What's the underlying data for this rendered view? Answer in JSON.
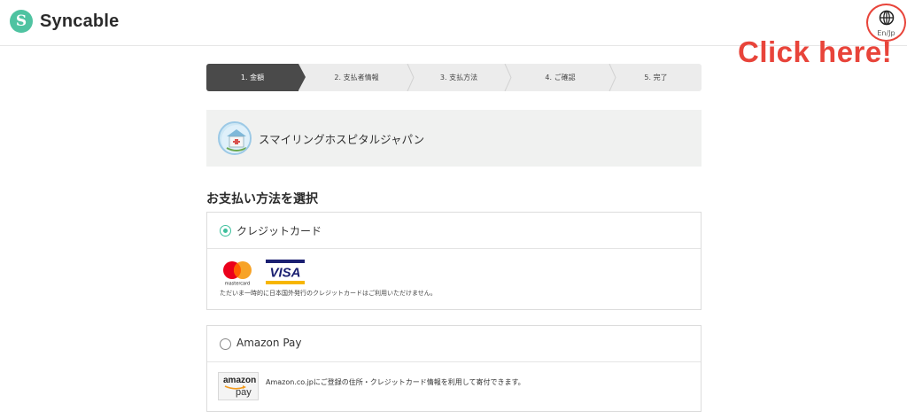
{
  "header": {
    "logo_letter": "S",
    "brand": "Syncable",
    "lang_toggle": "En/Jp",
    "annotation": "Click here!"
  },
  "stepper": {
    "steps": [
      {
        "label": "1. 金額",
        "active": true
      },
      {
        "label": "2. 支払者情報",
        "active": false
      },
      {
        "label": "3. 支払方法",
        "active": false
      },
      {
        "label": "4. ご確認",
        "active": false
      },
      {
        "label": "5. 完了",
        "active": false
      }
    ]
  },
  "organization": {
    "name": "スマイリングホスピタルジャパン"
  },
  "payment": {
    "section_title": "お支払い方法を選択",
    "methods": [
      {
        "label": "クレジットカード",
        "selected": true,
        "brands": [
          "mastercard",
          "VISA"
        ],
        "note": "ただいま一時的に日本国外発行のクレジットカードはご利用いただけません。"
      },
      {
        "label": "Amazon Pay",
        "selected": false,
        "logo_text": "amazon",
        "logo_sub": "pay",
        "note": "Amazon.co.jpにご登録の住所・クレジットカード情報を利用して寄付できます。"
      }
    ]
  },
  "colors": {
    "accent": "#3dbf9c",
    "annotation": "#e8443a",
    "step_active": "#4a4a4a"
  }
}
